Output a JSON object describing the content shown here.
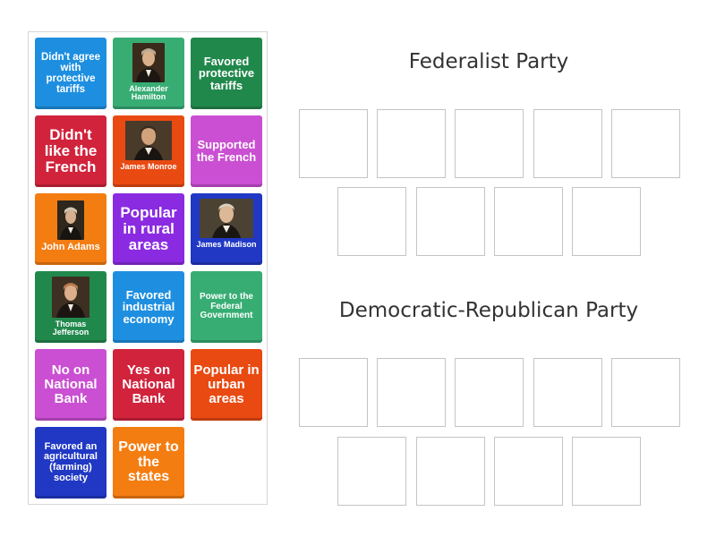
{
  "colors": {
    "blue": "#1e8fe0",
    "teal": "#37ad74",
    "green": "#21884c",
    "red": "#d1233c",
    "orange_red": "#e94a12",
    "magenta": "#ca4fd2",
    "orange": "#f47d12",
    "purple": "#8a2be2",
    "navy": "#2038c4"
  },
  "cards": [
    {
      "text": "Didn't agree with protective tariffs"
    },
    {
      "text": "Alexander Hamilton",
      "icon": "alexander-hamilton-portrait"
    },
    {
      "text": "Favored protective tariffs"
    },
    {
      "text": "Didn't like the French"
    },
    {
      "text": "James Monroe",
      "icon": "james-monroe-portrait"
    },
    {
      "text": "Supported the French"
    },
    {
      "text": "John Adams",
      "icon": "john-adams-portrait"
    },
    {
      "text": "Popular in rural areas"
    },
    {
      "text": "James Madison",
      "icon": "james-madison-portrait"
    },
    {
      "text": "Thomas Jefferson",
      "icon": "thomas-jefferson-portrait"
    },
    {
      "text": "Favored industrial economy"
    },
    {
      "text": "Power to the Federal Government"
    },
    {
      "text": "No on National Bank"
    },
    {
      "text": "Yes on National Bank"
    },
    {
      "text": "Popular in urban areas"
    },
    {
      "text": "Favored an agricultural (farming) society"
    },
    {
      "text": "Power to the states"
    }
  ],
  "groups": [
    {
      "title": "Federalist Party"
    },
    {
      "title": "Democratic-Republican Party"
    }
  ]
}
